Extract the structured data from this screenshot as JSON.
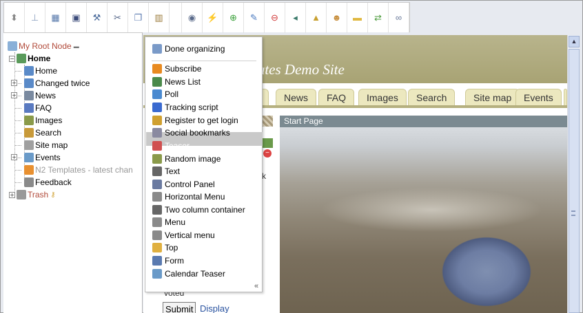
{
  "toolbar": {
    "buttons": [
      {
        "name": "move-arrows-icon",
        "glyph": "⬍",
        "color": "#888888"
      },
      {
        "name": "tree-structure-icon",
        "glyph": "⊥",
        "color": "#8aa0c0"
      },
      {
        "name": "page-list-icon",
        "glyph": "▦",
        "color": "#5577aa"
      },
      {
        "name": "building-icon",
        "glyph": "▣",
        "color": "#3b4b7a"
      },
      {
        "name": "wrench-icon",
        "glyph": "⚒",
        "color": "#4a6a9a"
      },
      {
        "name": "scissors-icon",
        "glyph": "✂",
        "color": "#556688"
      },
      {
        "name": "copy-icon",
        "glyph": "❐",
        "color": "#5a7ab0"
      },
      {
        "name": "paste-icon",
        "glyph": "▥",
        "color": "#9a7a3a"
      },
      {
        "name": "eye-icon",
        "glyph": "◉",
        "color": "#5a6a8a"
      },
      {
        "name": "magic-wand-icon",
        "glyph": "⚡",
        "color": "#c89030"
      },
      {
        "name": "add-icon",
        "glyph": "⊕",
        "color": "#3aa03a"
      },
      {
        "name": "edit-icon",
        "glyph": "✎",
        "color": "#4a7ac0"
      },
      {
        "name": "delete-icon",
        "glyph": "⊖",
        "color": "#d03a3a"
      },
      {
        "name": "move-left-icon",
        "glyph": "◂",
        "color": "#3a7a6a"
      },
      {
        "name": "lock-icon",
        "glyph": "▲",
        "color": "#c8a030"
      },
      {
        "name": "users-icon",
        "glyph": "☻",
        "color": "#c89040"
      },
      {
        "name": "folder-icon",
        "glyph": "▬",
        "color": "#e0b840"
      },
      {
        "name": "swap-icon",
        "glyph": "⇄",
        "color": "#4a9a3a"
      },
      {
        "name": "link-icon",
        "glyph": "∞",
        "color": "#6a7a9a"
      }
    ]
  },
  "tree": {
    "root": "My Root Node",
    "home": "Home",
    "children": [
      {
        "label": "Home",
        "icon": "page-icon",
        "color": "#5a8ac8"
      },
      {
        "label": "Changed twice",
        "icon": "page-icon",
        "color": "#5a8ac8"
      },
      {
        "label": "News",
        "icon": "news-icon",
        "color": "#7a8aa0"
      },
      {
        "label": "FAQ",
        "icon": "faq-icon",
        "color": "#5a7ac0"
      },
      {
        "label": "Images",
        "icon": "images-icon",
        "color": "#8a9a4a"
      },
      {
        "label": "Search",
        "icon": "search-icon",
        "color": "#c89a3a"
      },
      {
        "label": "Site map",
        "icon": "sitemap-icon",
        "color": "#a0a0a0"
      },
      {
        "label": "Events",
        "icon": "calendar-icon",
        "color": "#6a9ac8"
      },
      {
        "label": "N2 Templates - latest chan",
        "icon": "rss-icon",
        "color": "#e89030"
      },
      {
        "label": "Feedback",
        "icon": "form-icon",
        "color": "#8a8a8a"
      }
    ],
    "trash": "Trash"
  },
  "site": {
    "title": "lates Demo Site",
    "tabs": [
      "e",
      "News",
      "FAQ",
      "Images",
      "Search",
      "Site map",
      "Events"
    ],
    "start_page": "Start Page",
    "voted": "voted",
    "submit": "Submit",
    "display": "Display",
    "side_mark": "k"
  },
  "menu": {
    "done": "Done organizing",
    "items": [
      {
        "label": "Subscribe",
        "icon": "rss-icon",
        "color": "#e88a20"
      },
      {
        "label": "News List",
        "icon": "news-icon",
        "color": "#4a8a4a"
      },
      {
        "label": "Poll",
        "icon": "poll-icon",
        "color": "#4a8ad0"
      },
      {
        "label": "Tracking script",
        "icon": "google-icon",
        "color": "#3a6ad0"
      },
      {
        "label": "Register to get login",
        "icon": "key-icon",
        "color": "#d0a030"
      },
      {
        "label": "Social bookmarks",
        "icon": "bookmarks-icon",
        "color": "#8a8aa0"
      },
      {
        "label": "Teaser",
        "icon": "heart-icon",
        "color": "#d05050"
      },
      {
        "label": "Random image",
        "icon": "image-icon",
        "color": "#8a9a4a"
      },
      {
        "label": "Text",
        "icon": "text-icon",
        "color": "#666666"
      },
      {
        "label": "Control Panel",
        "icon": "control-panel-icon",
        "color": "#6a7aa0"
      },
      {
        "label": "Horizontal Menu",
        "icon": "menu-icon",
        "color": "#8a8a8a"
      },
      {
        "label": "Two column container",
        "icon": "columns-icon",
        "color": "#666666"
      },
      {
        "label": "Menu",
        "icon": "menu-icon",
        "color": "#8a8a8a"
      },
      {
        "label": "Vertical menu",
        "icon": "menu-icon",
        "color": "#8a8a8a"
      },
      {
        "label": "Top",
        "icon": "top-icon",
        "color": "#e0b040"
      },
      {
        "label": "Form",
        "icon": "form-icon",
        "color": "#5a7ab0"
      },
      {
        "label": "Calendar Teaser",
        "icon": "calendar-icon",
        "color": "#6a9ac8"
      }
    ],
    "highlighted": "Teaser",
    "collapse": "«"
  },
  "colors": {
    "header": "#a8a374",
    "tab_bg": "#ece8bf",
    "start_bar": "#7b8a91",
    "root_link": "#b14a3a"
  }
}
